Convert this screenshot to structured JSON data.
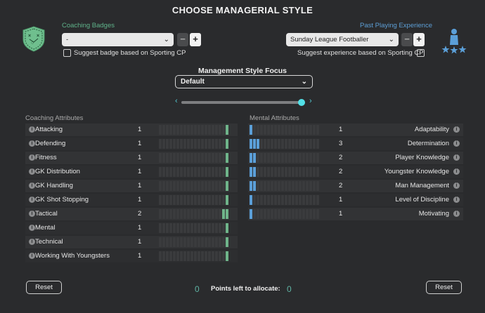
{
  "title": "CHOOSE MANAGERIAL STYLE",
  "coaching_badges": {
    "label": "Coaching Badges",
    "value": "-",
    "suggest_label": "Suggest badge based on Sporting CP",
    "icon": "tactics-board-badge-icon"
  },
  "playing_experience": {
    "label": "Past Playing Experience",
    "value": "Sunday League Footballer",
    "suggest_label": "Suggest experience based on Sporting CP",
    "icon": "player-stars-icon"
  },
  "focus": {
    "title": "Management Style Focus",
    "value": "Default",
    "slider_fraction": 0.97
  },
  "coaching": {
    "header": "Coaching Attributes",
    "items": [
      {
        "name": "Attacking",
        "value": "1",
        "level": 1
      },
      {
        "name": "Defending",
        "value": "1",
        "level": 1
      },
      {
        "name": "Fitness",
        "value": "1",
        "level": 1
      },
      {
        "name": "GK Distribution",
        "value": "1",
        "level": 1
      },
      {
        "name": "GK Handling",
        "value": "1",
        "level": 1
      },
      {
        "name": "GK Shot Stopping",
        "value": "1",
        "level": 1
      },
      {
        "name": "Tactical",
        "value": "2",
        "level": 2
      },
      {
        "name": "Mental",
        "value": "1",
        "level": 1
      },
      {
        "name": "Technical",
        "value": "1",
        "level": 1
      },
      {
        "name": "Working With Youngsters",
        "value": "1",
        "level": 1
      }
    ]
  },
  "mental": {
    "header": "Mental Attributes",
    "items": [
      {
        "name": "Adaptability",
        "value": "1",
        "level": 1
      },
      {
        "name": "Determination",
        "value": "3",
        "level": 3
      },
      {
        "name": "Player Knowledge",
        "value": "2",
        "level": 2
      },
      {
        "name": "Youngster Knowledge",
        "value": "2",
        "level": 2
      },
      {
        "name": "Man Management",
        "value": "2",
        "level": 2
      },
      {
        "name": "Level of Discipline",
        "value": "1",
        "level": 1
      },
      {
        "name": "Motivating",
        "value": "1",
        "level": 1
      }
    ]
  },
  "footer": {
    "reset_label": "Reset",
    "points_label": "Points left to allocate:",
    "points_left_a": "0",
    "points_left_b": "0"
  },
  "colors": {
    "coaching_bar": "#6fb48a",
    "mental_bar": "#5b9fd8",
    "accent_cyan": "#52e0e6"
  }
}
